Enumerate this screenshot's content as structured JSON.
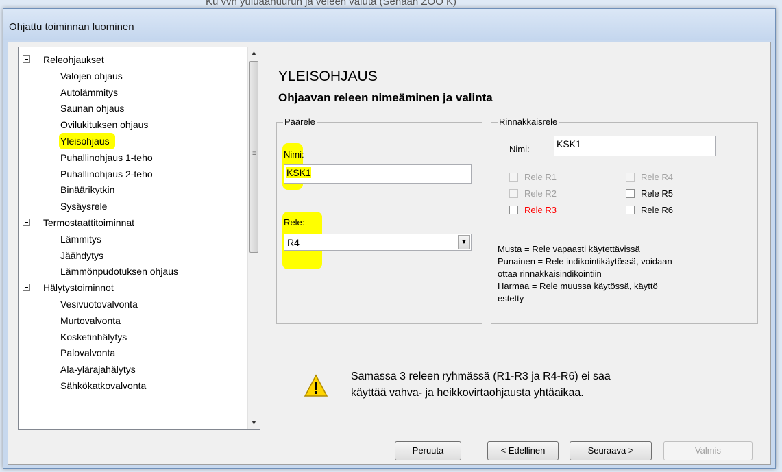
{
  "background_title": "Ku vvn yuiuaanuurun ja veleen vaiuta (Senaan ZOO K)",
  "window": {
    "title": "Ohjattu toiminnan luominen"
  },
  "tree": {
    "items": [
      {
        "label": "Releohjaukset",
        "level": 0
      },
      {
        "label": "Valojen ohjaus",
        "level": 1
      },
      {
        "label": "Autolämmitys",
        "level": 1
      },
      {
        "label": "Saunan ohjaus",
        "level": 1
      },
      {
        "label": "Ovilukituksen ohjaus",
        "level": 1
      },
      {
        "label": "Yleisohjaus",
        "level": 1,
        "highlighted": true
      },
      {
        "label": "Puhallinohjaus 1-teho",
        "level": 1
      },
      {
        "label": "Puhallinohjaus 2-teho",
        "level": 1
      },
      {
        "label": "Binäärikytkin",
        "level": 1
      },
      {
        "label": "Sysäysrele",
        "level": 1
      },
      {
        "label": "Termostaattitoiminnat",
        "level": 0
      },
      {
        "label": "Lämmitys",
        "level": 1
      },
      {
        "label": "Jäähdytys",
        "level": 1
      },
      {
        "label": "Lämmönpudotuksen ohjaus",
        "level": 1
      },
      {
        "label": "Hälytystoiminnot",
        "level": 0
      },
      {
        "label": "Vesivuotovalvonta",
        "level": 1
      },
      {
        "label": "Murtovalvonta",
        "level": 1
      },
      {
        "label": "Kosketinhälytys",
        "level": 1
      },
      {
        "label": "Palovalvonta",
        "level": 1
      },
      {
        "label": "Ala-ylärajahälytys",
        "level": 1
      },
      {
        "label": "Sähkökatkovalvonta",
        "level": 1
      }
    ]
  },
  "panel": {
    "heading": "YLEISOHJAUS",
    "subheading": "Ohjaavan releen nimeäminen ja valinta",
    "paarele": {
      "group_label": "Päärele",
      "name_label": "Nimi:",
      "name_value": "KSK1",
      "rele_label": "Rele:",
      "rele_value": "R4"
    },
    "rinnakkaisrele": {
      "group_label": "Rinnakkaisrele",
      "name_label": "Nimi:",
      "name_value": "KSK1",
      "checkboxes": [
        {
          "label": "Rele R1",
          "state": "disabled"
        },
        {
          "label": "Rele R2",
          "state": "disabled"
        },
        {
          "label": "Rele R3",
          "state": "red"
        },
        {
          "label": "Rele R4",
          "state": "disabled"
        },
        {
          "label": "Rele R5",
          "state": "normal"
        },
        {
          "label": "Rele R6",
          "state": "normal"
        }
      ],
      "legend": [
        "Musta = Rele vapaasti käytettävissä",
        "Punainen = Rele indikointikäytössä, voidaan",
        "ottaa rinnakkaisindikointiin",
        "Harmaa = Rele muussa käytössä, käyttö",
        "estetty"
      ]
    },
    "warning": {
      "line1": "Samassa 3 releen ryhmässä (R1-R3 ja R4-R6) ei saa",
      "line2": "käyttää vahva- ja heikkovirtaohjausta yhtäaikaa."
    }
  },
  "buttons": {
    "cancel": "Peruuta",
    "back": "< Edellinen",
    "next": "Seuraava >",
    "finish": "Valmis"
  },
  "colors": {
    "highlight": "#ffff00",
    "red_label": "#ff0000",
    "disabled_text": "#a0a0a0"
  }
}
